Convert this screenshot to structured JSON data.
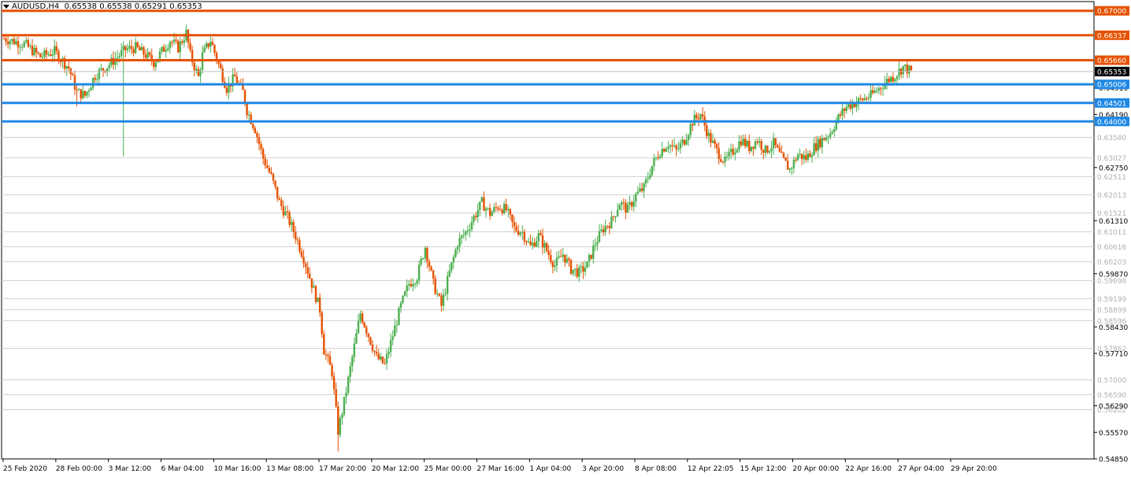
{
  "header": {
    "symbol": "AUDUSD,H4",
    "ohlc": "0.65538 0.65538 0.65291 0.65353"
  },
  "colors": {
    "bull": "#26a69a",
    "bull_body": "#4caf50",
    "bear": "#e65100",
    "resistance": "#e65100",
    "support": "#1e88e5",
    "current_price_bg": "#000000",
    "grid": "#d3d3d3"
  },
  "chart_data": {
    "type": "candlestick",
    "title": "AUDUSD,H4",
    "ylim": [
      0.5485,
      0.6725
    ],
    "grid": true,
    "y_tick_labels": [
      "0.54850",
      "0.55570",
      "0.56290",
      "0.57710",
      "0.58430",
      "0.59870",
      "0.61310",
      "0.62750",
      "0.64190",
      "0.64910"
    ],
    "x_tick_labels": [
      "25 Feb 2020",
      "28 Feb 00:00",
      "3 Mar 12:00",
      "6 Mar 04:00",
      "10 Mar 16:00",
      "13 Mar 08:00",
      "17 Mar 20:00",
      "20 Mar 12:00",
      "25 Mar 00:00",
      "27 Mar 16:00",
      "1 Apr 04:00",
      "3 Apr 20:00",
      "8 Apr 08:00",
      "12 Apr 22:05",
      "15 Apr 12:00",
      "20 Apr 00:00",
      "22 Apr 16:00",
      "27 Apr 04:00",
      "29 Apr 20:00"
    ],
    "resistance_levels": [
      {
        "value": 0.67,
        "label": "0.67000"
      },
      {
        "value": 0.66337,
        "label": "0.66337"
      },
      {
        "value": 0.6566,
        "label": "0.65660"
      }
    ],
    "support_levels": [
      {
        "value": 0.65006,
        "label": "0.65006"
      },
      {
        "value": 0.64501,
        "label": "0.64501"
      },
      {
        "value": 0.64,
        "label": "0.64000"
      }
    ],
    "current_price": {
      "value": 0.65353,
      "label": "0.65353"
    },
    "horizontal_levels": [
      {
        "value": 0.6358,
        "label": "0.63580"
      },
      {
        "value": 0.63027,
        "label": "0.63027"
      },
      {
        "value": 0.62511,
        "label": "0.62511"
      },
      {
        "value": 0.62013,
        "label": "0.62013"
      },
      {
        "value": 0.61521,
        "label": "0.61521"
      },
      {
        "value": 0.61011,
        "label": "0.61011"
      },
      {
        "value": 0.60616,
        "label": "0.60616"
      },
      {
        "value": 0.60203,
        "label": "0.60203"
      },
      {
        "value": 0.59698,
        "label": "0.59698"
      },
      {
        "value": 0.59199,
        "label": "0.59199"
      },
      {
        "value": 0.58899,
        "label": "0.58899"
      },
      {
        "value": 0.58596,
        "label": "0.58596"
      },
      {
        "value": 0.57862,
        "label": "0.57862"
      },
      {
        "value": 0.57,
        "label": "0.57000"
      },
      {
        "value": 0.5659,
        "label": "0.56590"
      },
      {
        "value": 0.56202,
        "label": "0.56202"
      }
    ],
    "close_path": [
      [
        0,
        0.6625
      ],
      [
        10,
        0.661
      ],
      [
        18,
        0.6575
      ],
      [
        25,
        0.659
      ],
      [
        32,
        0.6545
      ],
      [
        36,
        0.648
      ],
      [
        40,
        0.647
      ],
      [
        45,
        0.6525
      ],
      [
        52,
        0.6555
      ],
      [
        60,
        0.6595
      ],
      [
        65,
        0.66
      ],
      [
        70,
        0.658
      ],
      [
        74,
        0.656
      ],
      [
        78,
        0.659
      ],
      [
        82,
        0.662
      ],
      [
        86,
        0.66
      ],
      [
        90,
        0.664
      ],
      [
        92,
        0.658
      ],
      [
        96,
        0.652
      ],
      [
        98,
        0.658
      ],
      [
        102,
        0.662
      ],
      [
        106,
        0.6555
      ],
      [
        110,
        0.649
      ],
      [
        114,
        0.652
      ],
      [
        118,
        0.648
      ],
      [
        120,
        0.643
      ],
      [
        124,
        0.638
      ],
      [
        128,
        0.63
      ],
      [
        132,
        0.625
      ],
      [
        136,
        0.618
      ],
      [
        140,
        0.614
      ],
      [
        144,
        0.609
      ],
      [
        148,
        0.603
      ],
      [
        152,
        0.596
      ],
      [
        156,
        0.589
      ],
      [
        158,
        0.578
      ],
      [
        162,
        0.572
      ],
      [
        165,
        0.556
      ],
      [
        168,
        0.564
      ],
      [
        172,
        0.576
      ],
      [
        176,
        0.588
      ],
      [
        180,
        0.582
      ],
      [
        184,
        0.576
      ],
      [
        188,
        0.574
      ],
      [
        192,
        0.582
      ],
      [
        196,
        0.59
      ],
      [
        200,
        0.596
      ],
      [
        204,
        0.598
      ],
      [
        208,
        0.606
      ],
      [
        212,
        0.596
      ],
      [
        216,
        0.59
      ],
      [
        220,
        0.599
      ],
      [
        224,
        0.607
      ],
      [
        228,
        0.61
      ],
      [
        232,
        0.614
      ],
      [
        236,
        0.618
      ],
      [
        240,
        0.615
      ],
      [
        244,
        0.617
      ],
      [
        248,
        0.616
      ],
      [
        252,
        0.611
      ],
      [
        256,
        0.61
      ],
      [
        260,
        0.606
      ],
      [
        264,
        0.609
      ],
      [
        268,
        0.605
      ],
      [
        272,
        0.601
      ],
      [
        276,
        0.604
      ],
      [
        280,
        0.6
      ],
      [
        284,
        0.599
      ],
      [
        288,
        0.601
      ],
      [
        292,
        0.607
      ],
      [
        296,
        0.611
      ],
      [
        300,
        0.613
      ],
      [
        304,
        0.618
      ],
      [
        308,
        0.616
      ],
      [
        312,
        0.62
      ],
      [
        316,
        0.622
      ],
      [
        320,
        0.628
      ],
      [
        324,
        0.632
      ],
      [
        328,
        0.634
      ],
      [
        332,
        0.632
      ],
      [
        336,
        0.635
      ],
      [
        340,
        0.64
      ],
      [
        344,
        0.642
      ],
      [
        348,
        0.636
      ],
      [
        352,
        0.632
      ],
      [
        356,
        0.629
      ],
      [
        360,
        0.632
      ],
      [
        364,
        0.635
      ],
      [
        368,
        0.633
      ],
      [
        372,
        0.635
      ],
      [
        376,
        0.632
      ],
      [
        380,
        0.634
      ],
      [
        384,
        0.63
      ],
      [
        388,
        0.627
      ],
      [
        392,
        0.631
      ],
      [
        396,
        0.63
      ],
      [
        400,
        0.633
      ],
      [
        404,
        0.635
      ],
      [
        408,
        0.637
      ],
      [
        412,
        0.641
      ],
      [
        416,
        0.644
      ],
      [
        420,
        0.645
      ],
      [
        424,
        0.646
      ],
      [
        428,
        0.647
      ],
      [
        432,
        0.649
      ],
      [
        436,
        0.651
      ],
      [
        440,
        0.6525
      ],
      [
        444,
        0.6548
      ],
      [
        448,
        0.6535
      ]
    ]
  }
}
